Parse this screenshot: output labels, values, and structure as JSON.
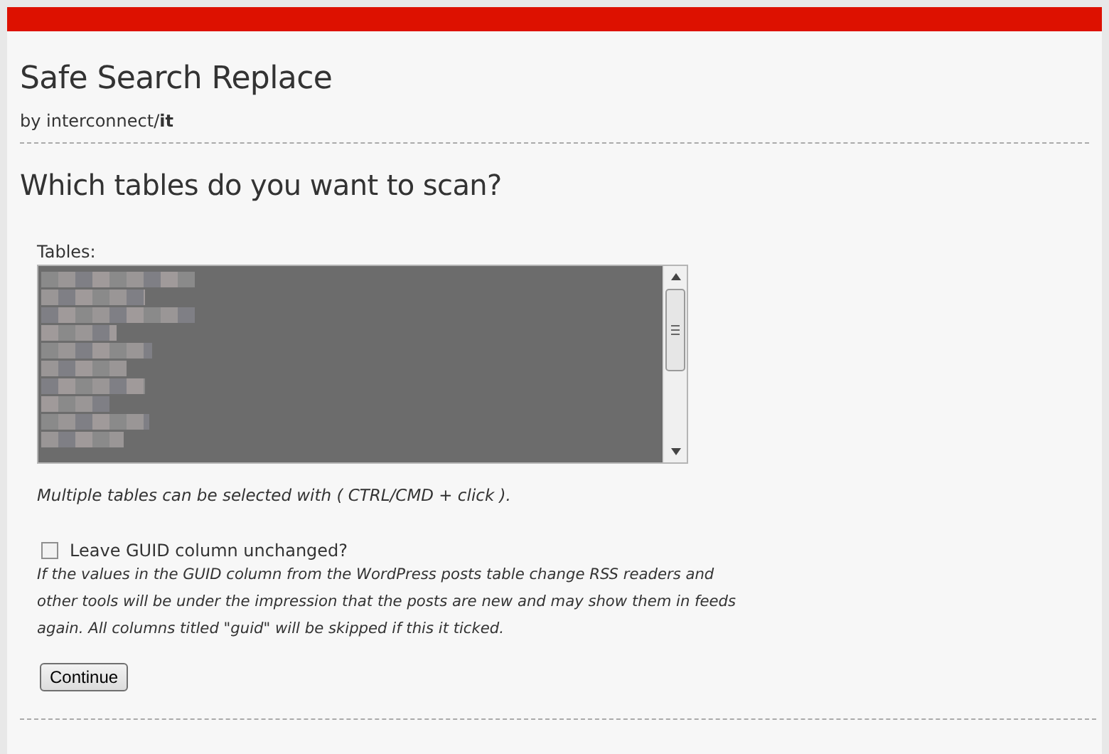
{
  "header": {
    "title": "Safe Search Replace",
    "byline": "by interconnect/**it**"
  },
  "section": {
    "heading": "Which tables do you want to scan?"
  },
  "tables": {
    "label": "Tables:",
    "all_selected": true,
    "hint": "Multiple tables can be selected with ( CTRL/CMD + click )."
  },
  "guid_option": {
    "label": "Leave GUID column unchanged?",
    "checked": false,
    "help": "If the values in the GUID column from the WordPress posts table change RSS readers and other tools will be under the impression that the posts are new and may show them in feeds again. All columns titled \"guid\" will be skipped if this it ticked."
  },
  "buttons": [
    {
      "label": "Continue"
    }
  ]
}
